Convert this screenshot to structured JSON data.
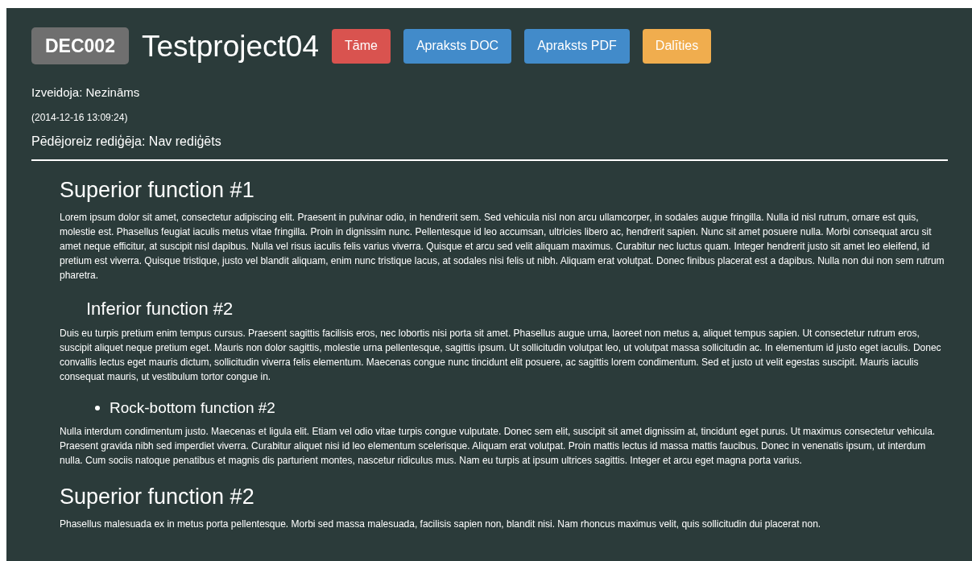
{
  "header": {
    "code": "DEC002",
    "title": "Testproject04",
    "buttons": [
      {
        "label": "Tāme",
        "color": "#d9534f"
      },
      {
        "label": "Apraksts DOC",
        "color": "#428bca"
      },
      {
        "label": "Apraksts PDF",
        "color": "#428bca"
      },
      {
        "label": "Dalīties",
        "color": "#f0ad4e"
      }
    ]
  },
  "meta": {
    "created_by": "Izveidoja: Nezināms",
    "created_at": "(2014-12-16 13:09:24)",
    "edited_by": "Pēdējoreiz rediģēja: Nav rediģēts"
  },
  "sections": [
    {
      "kind": "superior",
      "heading": "Superior function #1",
      "text": "Lorem ipsum dolor sit amet, consectetur adipiscing elit. Praesent in pulvinar odio, in hendrerit sem. Sed vehicula nisl non arcu ullamcorper, in sodales augue fringilla. Nulla id nisl rutrum, ornare est quis, molestie est. Phasellus feugiat iaculis metus vitae fringilla. Proin in dignissim nunc. Pellentesque id leo accumsan, ultricies libero ac, hendrerit sapien. Nunc sit amet posuere nulla. Morbi consequat arcu sit amet neque efficitur, at suscipit nisl dapibus. Nulla vel risus iaculis felis varius viverra. Quisque et arcu sed velit aliquam maximus. Curabitur nec luctus quam. Integer hendrerit justo sit amet leo eleifend, id pretium est viverra. Quisque tristique, justo vel blandit aliquam, enim nunc tristique lacus, at sodales nisi felis ut nibh. Aliquam erat volutpat. Donec finibus placerat est a dapibus. Nulla non dui non sem rutrum pharetra."
    },
    {
      "kind": "inferior",
      "heading": "Inferior function #2",
      "text": "Duis eu turpis pretium enim tempus cursus. Praesent sagittis facilisis eros, nec lobortis nisi porta sit amet. Phasellus augue urna, laoreet non metus a, aliquet tempus sapien. Ut consectetur rutrum eros, suscipit aliquet neque pretium eget. Mauris non dolor sagittis, molestie urna pellentesque, sagittis ipsum. Ut sollicitudin volutpat leo, ut volutpat massa sollicitudin ac. In elementum id justo eget iaculis. Donec convallis lectus eget mauris dictum, sollicitudin viverra felis elementum. Maecenas congue nunc tincidunt elit posuere, ac sagittis lorem condimentum. Sed et justo ut velit egestas suscipit. Mauris iaculis consequat mauris, ut vestibulum tortor congue in."
    },
    {
      "kind": "bullet",
      "heading": "Rock-bottom function #2",
      "text": "Nulla interdum condimentum justo. Maecenas et ligula elit. Etiam vel odio vitae turpis congue vulputate. Donec sem elit, suscipit sit amet dignissim at, tincidunt eget purus. Ut maximus consectetur vehicula. Praesent gravida nibh sed imperdiet viverra. Curabitur aliquet nisi id leo elementum scelerisque. Aliquam erat volutpat. Proin mattis lectus id massa mattis faucibus. Donec in venenatis ipsum, ut interdum nulla. Cum sociis natoque penatibus et magnis dis parturient montes, nascetur ridiculus mus. Nam eu turpis at ipsum ultrices sagittis. Integer et arcu eget magna porta varius."
    },
    {
      "kind": "superior",
      "heading": "Superior function #2",
      "text": "Phasellus malesuada ex in metus porta pellentesque. Morbi sed massa malesuada, facilisis sapien non, blandit nisi. Nam rhoncus maximus velit, quis sollicitudin dui placerat non."
    }
  ]
}
